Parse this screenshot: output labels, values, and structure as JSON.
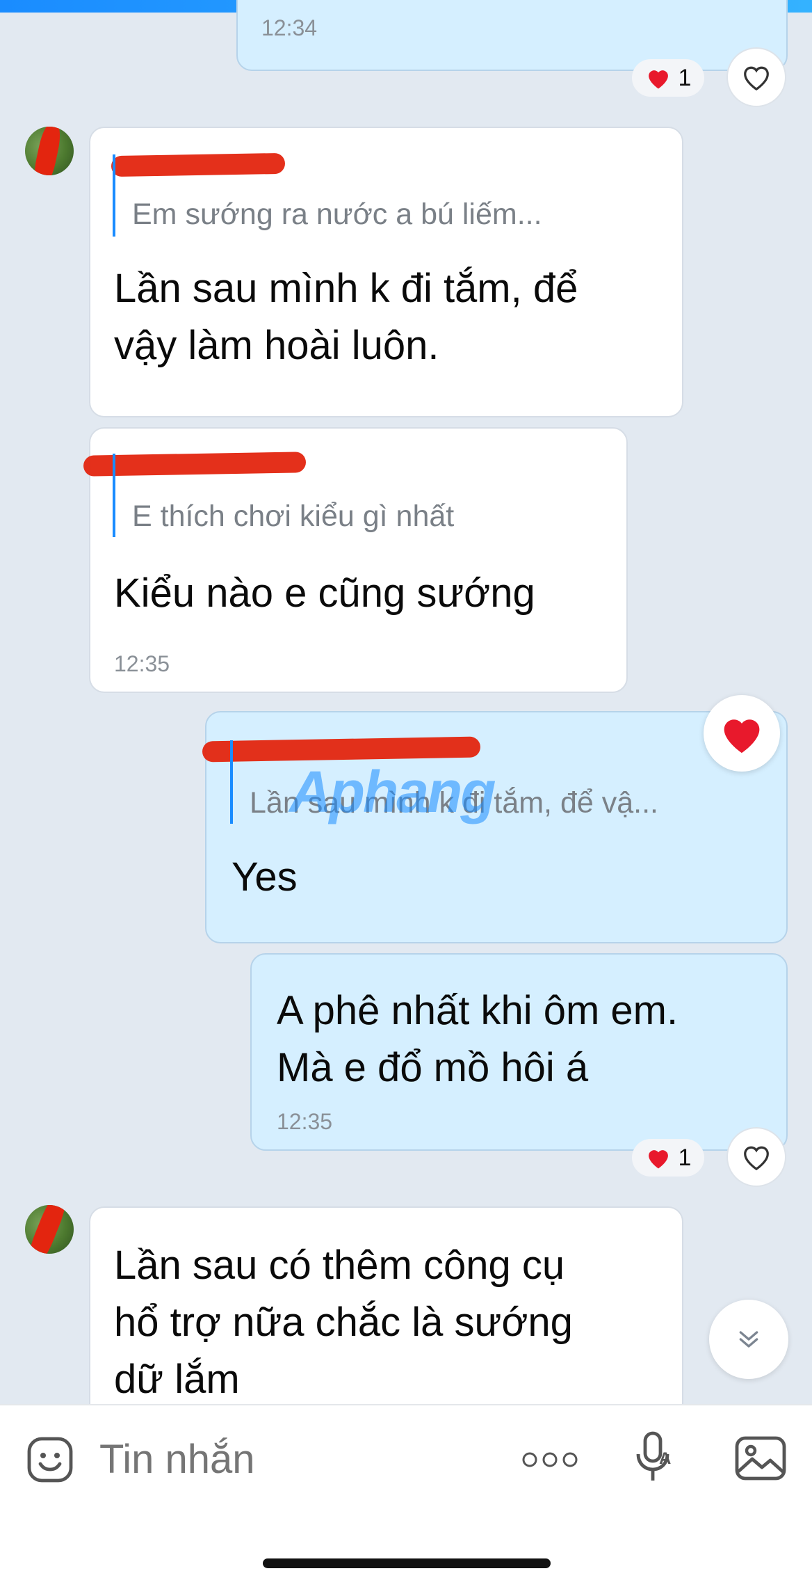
{
  "messages": [
    {
      "time": "12:34",
      "reaction_count": "1"
    },
    {
      "quote": "Em sướng ra nước a bú liếm...",
      "text_lines": [
        "Lần sau mình k đi tắm, để",
        "vậy làm hoài luôn."
      ]
    },
    {
      "quote": "E thích chơi kiểu gì nhất",
      "text": "Kiểu nào e cũng sướng",
      "time": "12:35"
    },
    {
      "quote": "Lần sau mình k đi tắm, để vậ...",
      "text": "Yes"
    },
    {
      "text_lines": [
        "A phê nhất khi ôm em.",
        "Mà e đổ mồ hôi á"
      ],
      "time": "12:35",
      "reaction_count": "1"
    },
    {
      "text_lines": [
        "Lần sau có thêm công cụ",
        "hổ trợ nữa chắc là sướng",
        "dữ lắm"
      ]
    }
  ],
  "watermark": "Aphang",
  "input": {
    "placeholder": "Tin nhắn"
  },
  "icons": {
    "sticker": "sticker-icon",
    "more": "more-icon",
    "voice": "microphone-icon",
    "gallery": "image-icon",
    "like": "heart-outline-icon",
    "reaction": "red-heart-icon",
    "scroll": "double-chevron-down-icon"
  },
  "colors": {
    "accent": "#1a8cff",
    "outgoing_bubble": "#d5efff",
    "incoming_bubble": "#ffffff",
    "heart": "#e8192c"
  }
}
